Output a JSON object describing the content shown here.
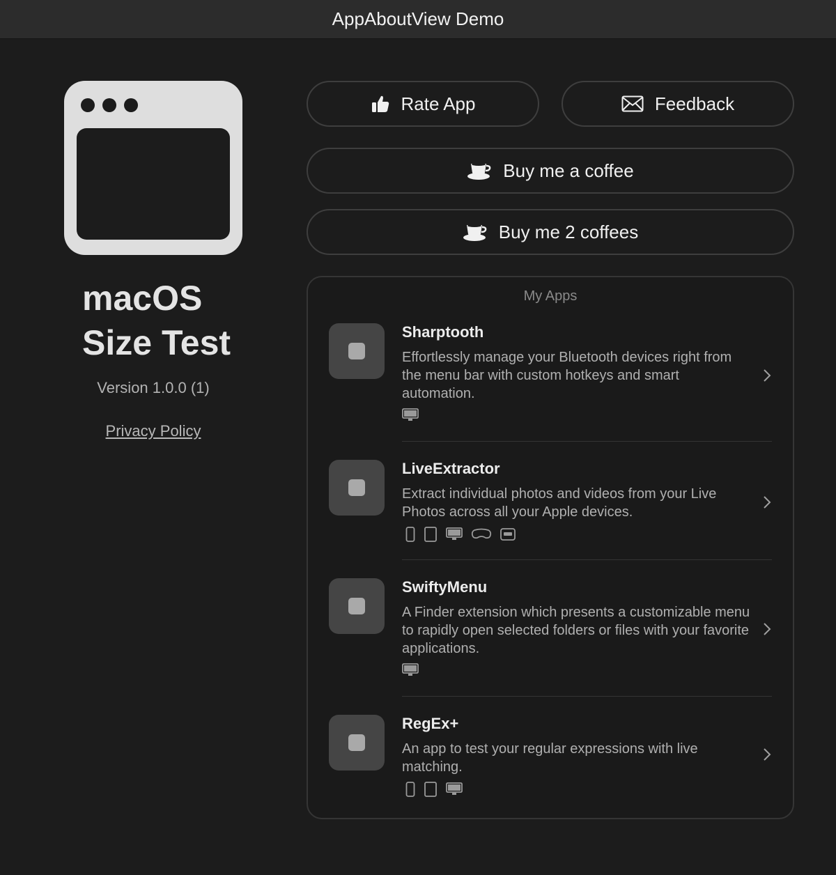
{
  "window": {
    "title": "AppAboutView Demo"
  },
  "about": {
    "app_name_line1": "macOS",
    "app_name_line2": "Size Test",
    "version": "Version 1.0.0 (1)",
    "privacy_link": "Privacy Policy"
  },
  "actions": {
    "rate_label": "Rate App",
    "feedback_label": "Feedback",
    "coffee1_label": "Buy me a coffee",
    "coffee2_label": "Buy me 2 coffees"
  },
  "my_apps": {
    "title": "My Apps",
    "items": [
      {
        "name": "Sharptooth",
        "description": "Effortlessly manage your Bluetooth devices right from the menu bar with custom hotkeys and smart automation.",
        "platforms": [
          "mac-icon"
        ]
      },
      {
        "name": "LiveExtractor",
        "description": "Extract individual photos and videos from your Live Photos across all your Apple devices.",
        "platforms": [
          "iphone-icon",
          "ipad-icon",
          "mac-icon",
          "vision-pro-icon",
          "apple-tv-icon"
        ]
      },
      {
        "name": "SwiftyMenu",
        "description": "A Finder extension which presents a customizable menu to rapidly open selected folders or files with your favorite applications.",
        "platforms": [
          "mac-icon"
        ]
      },
      {
        "name": "RegEx+",
        "description": "An app to test your regular expressions with live matching.",
        "platforms": [
          "iphone-icon",
          "ipad-icon",
          "mac-icon"
        ]
      }
    ]
  },
  "colors": {
    "background": "#1c1c1c",
    "titlebar": "#2c2c2c",
    "button_border": "#3e3e3e",
    "icon_tile": "#454545"
  }
}
